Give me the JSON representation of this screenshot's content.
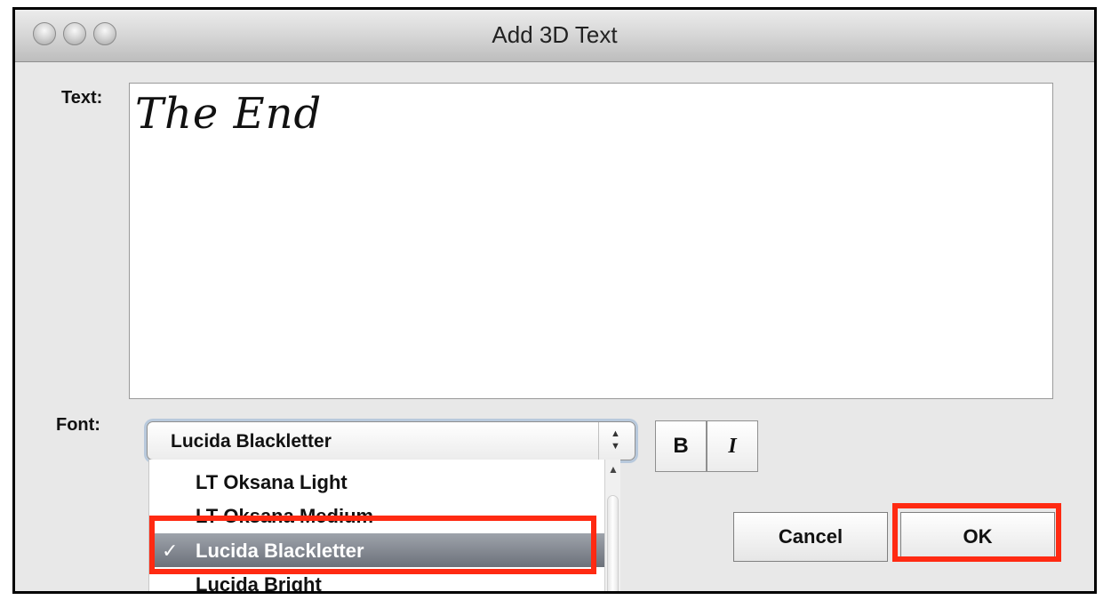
{
  "window": {
    "title": "Add 3D Text"
  },
  "text_field": {
    "label": "Text:",
    "value": "The End"
  },
  "font": {
    "label": "Font:",
    "selected": "Lucida Blackletter",
    "options": [
      {
        "label": "LT Oksana Light",
        "selected": false
      },
      {
        "label": "LT Oksana Medium",
        "selected": false
      },
      {
        "label": "Lucida Blackletter",
        "selected": true,
        "check": "✓"
      },
      {
        "label": "Lucida Bright",
        "selected": false
      }
    ]
  },
  "style_buttons": {
    "bold": "B",
    "italic": "I"
  },
  "buttons": {
    "cancel": "Cancel",
    "ok": "OK"
  },
  "annotation": {
    "highlight_color": "#ff2a12",
    "selection_color": "#7a7f88"
  }
}
